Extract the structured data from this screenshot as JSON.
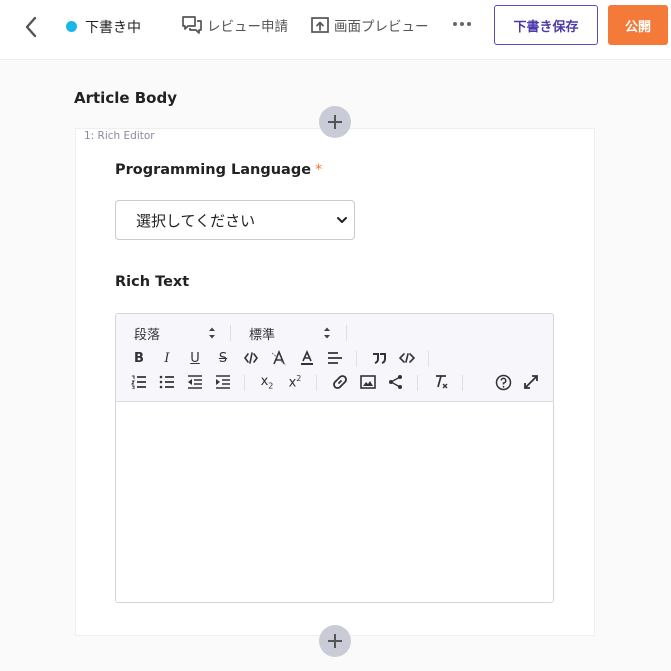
{
  "header": {
    "status_label": "下書き中",
    "review_label": "レビュー申請",
    "preview_label": "画面プレビュー",
    "save_draft_label": "下書き保存",
    "publish_label": "公開",
    "status_color": "#1bb6e8",
    "accent_color": "#f47a3a"
  },
  "content": {
    "section_title": "Article Body",
    "block_tag": "1: Rich Editor",
    "language_label": "Programming Language",
    "required_mark": "*",
    "language_select_value": "選択してください",
    "rich_text_label": "Rich Text"
  },
  "editor": {
    "format_select": "段落",
    "size_select": "標準",
    "icons": [
      "bold-icon",
      "italic-icon",
      "underline-icon",
      "strikethrough-icon",
      "inline-code-icon",
      "clear-background-icon",
      "font-color-icon",
      "align-icon",
      "blockquote-icon",
      "code-block-icon",
      "ordered-list-icon",
      "bullet-list-icon",
      "outdent-icon",
      "indent-icon",
      "subscript-icon",
      "superscript-icon",
      "link-icon",
      "image-icon",
      "share-icon",
      "clear-format-icon",
      "help-icon",
      "fullscreen-icon"
    ]
  }
}
